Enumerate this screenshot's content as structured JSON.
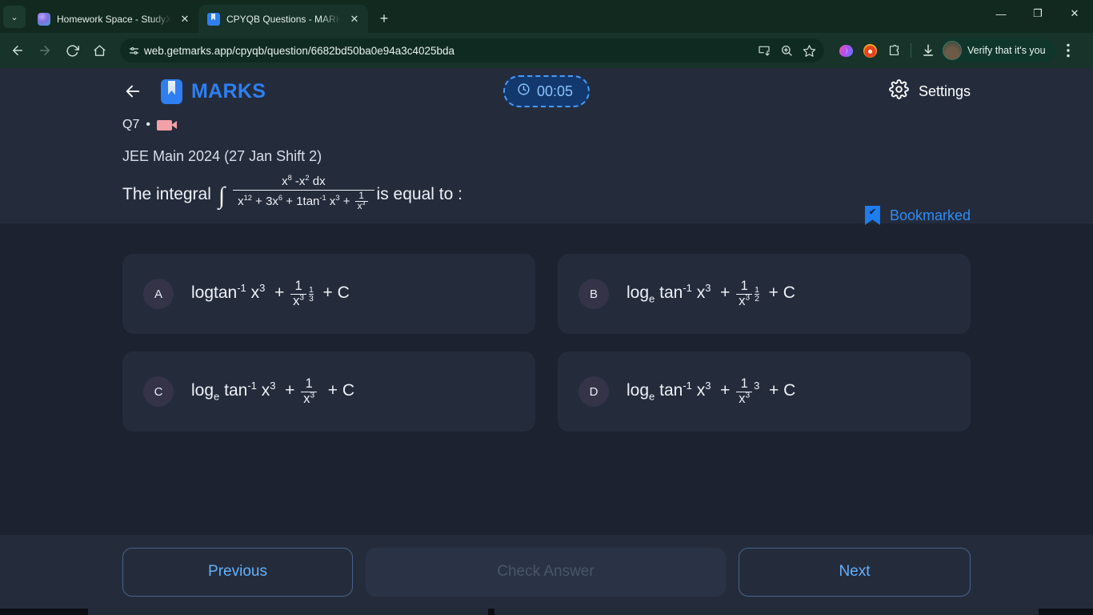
{
  "browser": {
    "tabs": [
      {
        "title": "Homework Space - StudyX",
        "favicon": "studyx-icon",
        "active": false
      },
      {
        "title": "CPYQB Questions - MARKS App",
        "favicon": "marks-icon",
        "active": true
      }
    ],
    "new_tab_label": "+",
    "tab_search_label": "⌄",
    "window_controls": {
      "minimize": "—",
      "maximize": "❐",
      "close": "✕"
    },
    "nav": {
      "back": "←",
      "forward": "→",
      "reload": "⟳",
      "home": "⌂"
    },
    "omnibox": {
      "url": "web.getmarks.app/cpyqb/question/6682bd50ba0e94a3c4025bda",
      "site_info_icon": "tune-icon",
      "install_icon": "install-app-icon",
      "zoom_icon": "zoom-in-icon",
      "bookmark_icon": "star-icon"
    },
    "extensions": [
      {
        "name": "brain-extension-icon"
      },
      {
        "name": "orange-extension-icon"
      },
      {
        "name": "puzzle-extensions-icon"
      }
    ],
    "downloads_icon": "download-icon",
    "profile": {
      "label": "Verify that it's you",
      "avatar": "profile-avatar"
    },
    "menu_icon": "kebab-menu-icon"
  },
  "app": {
    "back_label": "←",
    "brand": "MARKS",
    "timer": {
      "value": "00:05",
      "icon": "clock-icon"
    },
    "settings": {
      "label": "Settings",
      "icon": "gear-icon"
    }
  },
  "question": {
    "number": "Q7",
    "separator": "•",
    "video_icon": "video-camera-icon",
    "bookmark": {
      "label": "Bookmarked",
      "icon": "bookmark-check-icon"
    },
    "source": "JEE Main 2024 (27 Jan Shift 2)",
    "prefix": "The integral",
    "suffix": "is equal to :",
    "integral_symbol": "∫",
    "numerator_parts": {
      "base1": "x",
      "exp1": "8",
      "minus": "-",
      "base2": "x",
      "exp2": "2",
      "dx": "dx"
    },
    "denominator_parts": {
      "t1_base": "x",
      "t1_exp": "12",
      "plus1": "+",
      "t2": "3x",
      "t2_exp": "6",
      "plus2": "+",
      "t3": "1tan",
      "t3_exp": "-1",
      "t4_base": "x",
      "t4_exp": "3",
      "plus3": "+",
      "frac_num": "1",
      "frac_den_base": "x",
      "frac_den_exp": "3"
    }
  },
  "options": [
    {
      "badge": "A",
      "log_base": "",
      "log_text": "logtan",
      "tan_exp": "-1",
      "var": "x",
      "var_exp": "3",
      "plus": "+",
      "frac_num": "1",
      "frac_den": "x",
      "frac_den_exp": "3",
      "outer_exp_num": "1",
      "outer_exp_den": "3",
      "tail": "+ C"
    },
    {
      "badge": "B",
      "log_base": "e",
      "log_text": "log",
      "tan_text": "tan",
      "tan_exp": "-1",
      "var": "x",
      "var_exp": "3",
      "plus": "+",
      "frac_num": "1",
      "frac_den": "x",
      "frac_den_exp": "3",
      "outer_exp_num": "1",
      "outer_exp_den": "2",
      "tail": "+ C"
    },
    {
      "badge": "C",
      "log_base": "e",
      "log_text": "log",
      "tan_text": "tan",
      "tan_exp": "-1",
      "var": "x",
      "var_exp": "3",
      "plus": "+",
      "frac_num": "1",
      "frac_den": "x",
      "frac_den_exp": "3",
      "outer_exp": "",
      "tail": "+ C"
    },
    {
      "badge": "D",
      "log_base": "e",
      "log_text": "log",
      "tan_text": "tan",
      "tan_exp": "-1",
      "var": "x",
      "var_exp": "3",
      "plus": "+",
      "frac_num": "1",
      "frac_den": "x",
      "frac_den_exp": "3",
      "outer_exp": "3",
      "tail": "+ C"
    }
  ],
  "footer": {
    "previous": "Previous",
    "check_answer": "Check Answer",
    "next": "Next"
  },
  "colors": {
    "browser_chrome": "#11291f",
    "toolbar": "#17332a",
    "page_bg": "#1c2230",
    "panel_bg": "#242c3c",
    "accent_blue": "#2f7ff0",
    "link_blue": "#65b0fb",
    "timer_bg": "#12386e",
    "timer_border": "#4c9bf5"
  }
}
